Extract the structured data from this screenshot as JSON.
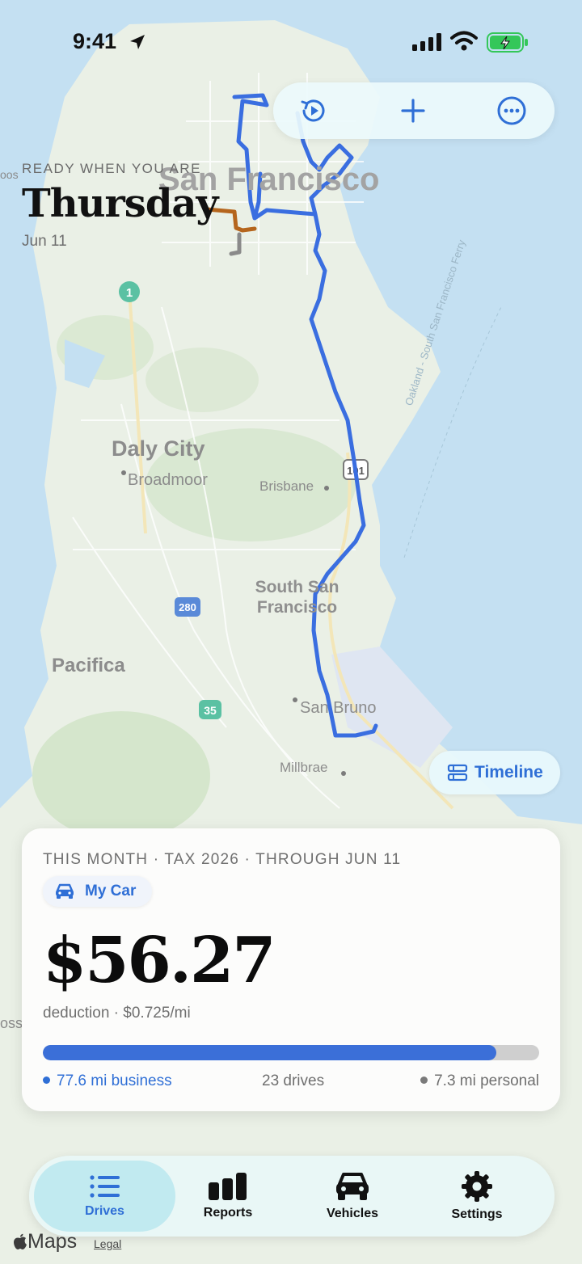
{
  "status_bar": {
    "time": "9:41"
  },
  "header": {
    "eyebrow": "READY WHEN YOU ARE",
    "day": "Thursday",
    "date": "Jun 11"
  },
  "toolbar": {
    "buttons": [
      "replay-icon",
      "plus-icon",
      "more-icon"
    ]
  },
  "map": {
    "labels": {
      "san_francisco": "San Francisco",
      "daly_city": "Daly City",
      "broadmoor": "Broadmoor",
      "brisbane": "Brisbane",
      "south_san_francisco": "South San Francisco",
      "pacifica": "Pacifica",
      "san_bruno": "San Bruno",
      "millbrae": "Millbrae",
      "ferry": "Oakland - South San Francisco Ferry",
      "edge_left": "oos",
      "edge_left2": "oss"
    },
    "shields": {
      "route_1": "1",
      "route_101": "101",
      "route_280": "280",
      "route_35": "35"
    },
    "route_colors": {
      "business": "#3a6ee0",
      "detour": "#b5651d",
      "personal": "#8a8a8a"
    }
  },
  "timeline_button": {
    "label": "Timeline"
  },
  "summary": {
    "eyebrow": "THIS MONTH · TAX 2026 · THROUGH JUN 11",
    "vehicle": "My Car",
    "amount": "$56.27",
    "rate": "deduction · $0.725/mi",
    "business_fraction": 0.914,
    "business": "77.6 mi business",
    "drives": "23 drives",
    "personal": "7.3 mi personal",
    "accent_color": "#2f6fd6"
  },
  "tabs": [
    {
      "label": "Drives",
      "icon": "list-icon",
      "active": true
    },
    {
      "label": "Reports",
      "icon": "bar-chart-icon",
      "active": false
    },
    {
      "label": "Vehicles",
      "icon": "car-icon",
      "active": false
    },
    {
      "label": "Settings",
      "icon": "gear-icon",
      "active": false
    }
  ],
  "footer": {
    "maps": "Maps",
    "legal": "Legal"
  }
}
